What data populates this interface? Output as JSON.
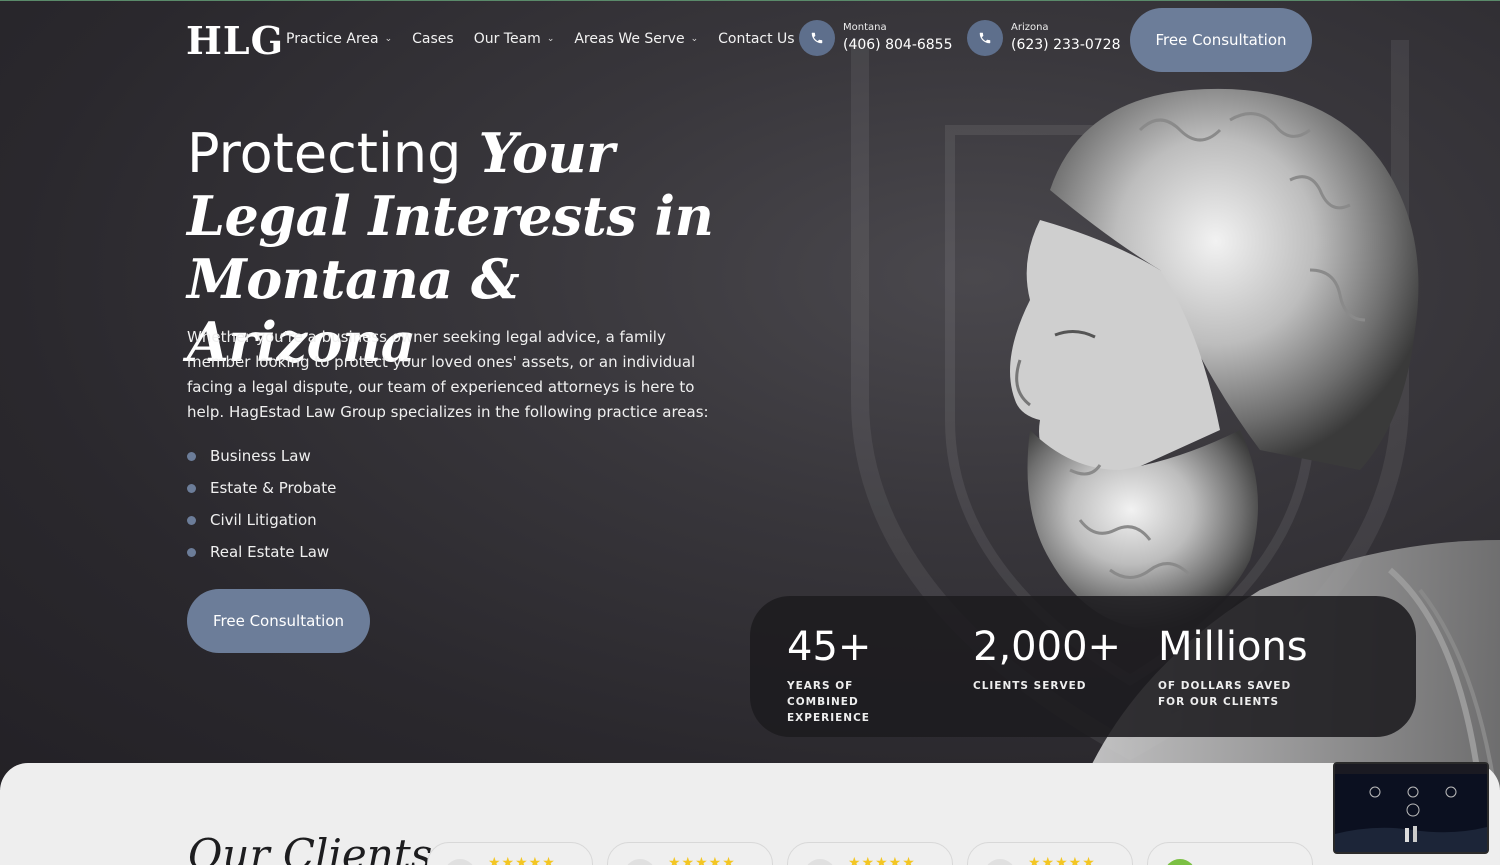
{
  "header": {
    "logo": "HLG",
    "nav": [
      {
        "label": "Practice Area",
        "dropdown": true
      },
      {
        "label": "Cases",
        "dropdown": false
      },
      {
        "label": "Our Team",
        "dropdown": true
      },
      {
        "label": "Areas We Serve",
        "dropdown": true
      },
      {
        "label": "Contact Us",
        "dropdown": false
      }
    ],
    "phones": [
      {
        "region": "Montana",
        "number": "(406) 804-6855"
      },
      {
        "region": "Arizona",
        "number": "(623) 233-0728"
      }
    ],
    "cta": "Free Consultation"
  },
  "hero": {
    "headline_sans": "Protecting ",
    "headline_serif": "Your Legal Interests in Montana & Arizona",
    "intro": "Whether you're a business owner seeking legal advice, a family member looking to protect your loved ones' assets, or an individual facing a legal dispute, our team of experienced attorneys is here to help. HagEstad Law Group specializes in the following practice areas:",
    "practice_areas": [
      "Business Law",
      "Estate & Probate",
      "Civil Litigation",
      "Real Estate Law"
    ],
    "cta": "Free Consultation"
  },
  "stats": [
    {
      "number": "45+",
      "label": "Years of combined experience"
    },
    {
      "number": "2,000+",
      "label": "Clients served"
    },
    {
      "number": "Millions",
      "label": "of dollars saved for our clients"
    }
  ],
  "clients": {
    "title": "Our Clients",
    "reviews": [
      {
        "stars": "★★★★★"
      },
      {
        "stars": "★★★★★"
      },
      {
        "stars": "★★★★★"
      },
      {
        "stars": "★★★★★"
      },
      {
        "stars": ""
      }
    ]
  },
  "colors": {
    "accent": "#6c7d99",
    "phone_icon_bg": "#5e6f8c",
    "hero_bg": "#2f2d32",
    "star": "#f3c623"
  },
  "icons": {
    "phone": "phone-icon",
    "chevron": "chevron-down-icon",
    "bullet": "bullet-dot-icon"
  }
}
